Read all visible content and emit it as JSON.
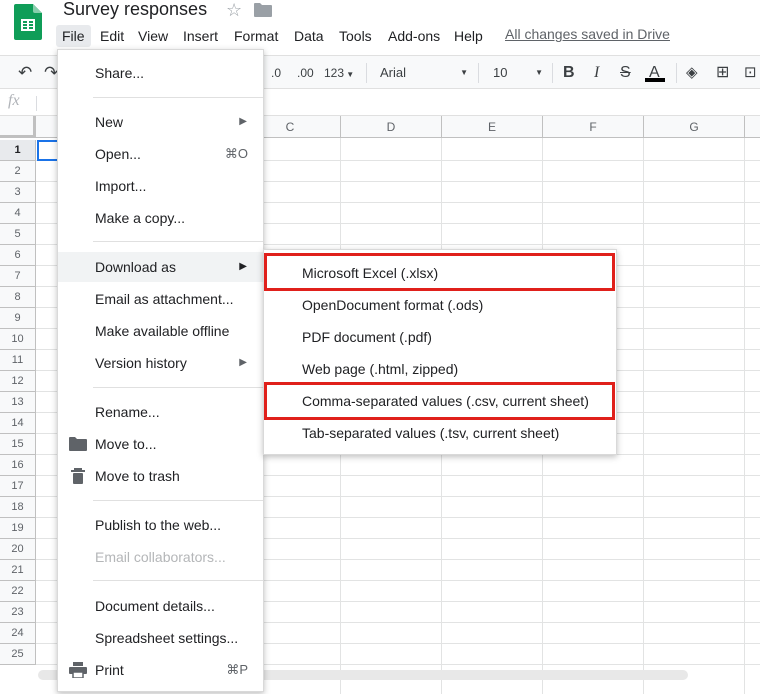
{
  "document": {
    "title": "Survey responses",
    "saved_status": "All changes saved in Drive"
  },
  "menubar": [
    "File",
    "Edit",
    "View",
    "Insert",
    "Format",
    "Data",
    "Tools",
    "Add-ons",
    "Help"
  ],
  "toolbar": {
    "decimal_decrease": ".0",
    "decimal_increase": ".00",
    "number_format": "123",
    "font": "Arial",
    "font_size": "10",
    "bold": "B",
    "italic": "I",
    "strikethrough": "S",
    "text_color": "A"
  },
  "formula_bar": {
    "label": "fx"
  },
  "grid": {
    "columns": [
      "C",
      "D",
      "E",
      "F",
      "G"
    ],
    "rows": [
      "1",
      "2",
      "3",
      "4",
      "5",
      "6",
      "7",
      "8",
      "9",
      "10",
      "11",
      "12",
      "13",
      "14",
      "15",
      "16",
      "17",
      "18",
      "19",
      "20",
      "21",
      "22",
      "23",
      "24",
      "25"
    ]
  },
  "file_menu": {
    "share": "Share...",
    "new": "New",
    "open": "Open...",
    "open_shortcut": "⌘O",
    "import": "Import...",
    "make_copy": "Make a copy...",
    "download_as": "Download as",
    "email_attachment": "Email as attachment...",
    "offline": "Make available offline",
    "version_history": "Version history",
    "rename": "Rename...",
    "move_to": "Move to...",
    "move_trash": "Move to trash",
    "publish": "Publish to the web...",
    "email_collaborators": "Email collaborators...",
    "doc_details": "Document details...",
    "sheet_settings": "Spreadsheet settings...",
    "print": "Print",
    "print_shortcut": "⌘P"
  },
  "download_submenu": [
    "Microsoft Excel (.xlsx)",
    "OpenDocument format (.ods)",
    "PDF document (.pdf)",
    "Web page (.html, zipped)",
    "Comma-separated values (.csv, current sheet)",
    "Tab-separated values (.tsv, current sheet)"
  ],
  "colors": {
    "highlight": "#e0201b",
    "selection": "#1a73e8",
    "sheets_green": "#0f9d58"
  }
}
